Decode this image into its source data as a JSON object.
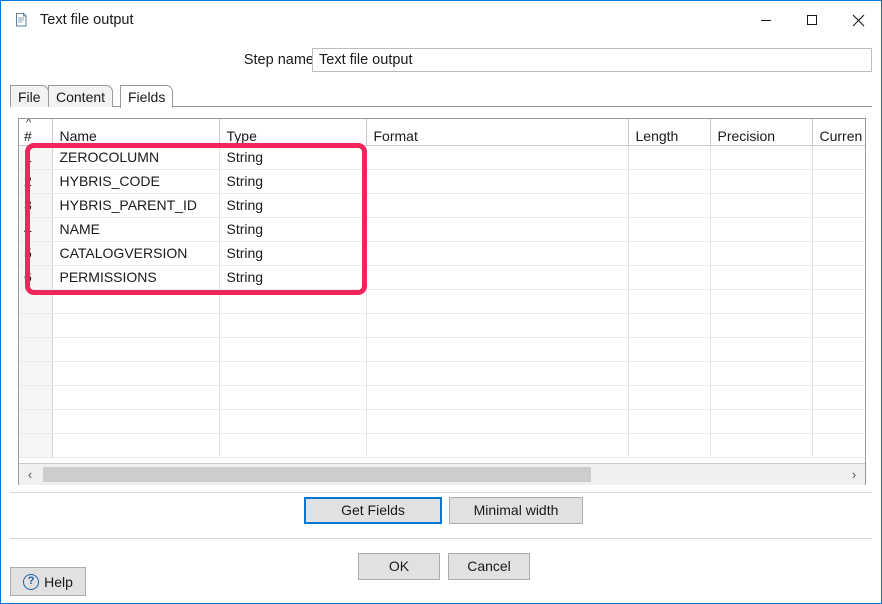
{
  "window": {
    "title": "Text file output",
    "icon": "text-file-document-icon",
    "controls": {
      "minimize": "minimize-icon",
      "maximize": "maximize-icon",
      "close": "close-icon"
    },
    "accent_border_color": "#0078d7"
  },
  "step": {
    "label": "Step name",
    "value": "Text file output",
    "placeholder": ""
  },
  "tabs": [
    {
      "label": "File",
      "active": false
    },
    {
      "label": "Content",
      "active": false
    },
    {
      "label": "Fields",
      "active": true
    }
  ],
  "table": {
    "sort_indicator": "^",
    "columns": [
      "#",
      "Name",
      "Type",
      "Format",
      "Length",
      "Precision",
      "Curren"
    ],
    "rows": [
      {
        "num": "1",
        "name": "ZEROCOLUMN",
        "type": "String",
        "format": "",
        "length": "",
        "precision": "",
        "currency": ""
      },
      {
        "num": "2",
        "name": "HYBRIS_CODE",
        "type": "String",
        "format": "",
        "length": "",
        "precision": "",
        "currency": ""
      },
      {
        "num": "3",
        "name": "HYBRIS_PARENT_ID",
        "type": "String",
        "format": "",
        "length": "",
        "precision": "",
        "currency": ""
      },
      {
        "num": "4",
        "name": "NAME",
        "type": "String",
        "format": "",
        "length": "",
        "precision": "",
        "currency": ""
      },
      {
        "num": "5",
        "name": "CATALOGVERSION",
        "type": "String",
        "format": "",
        "length": "",
        "precision": "",
        "currency": ""
      },
      {
        "num": "6",
        "name": "PERMISSIONS",
        "type": "String",
        "format": "",
        "length": "",
        "precision": "",
        "currency": ""
      }
    ],
    "empty_row_count": 7
  },
  "highlight": {
    "color": "#f0265c",
    "covers": "fields-rows-1-to-6-name-and-type"
  },
  "scrollbar": {
    "left_arrow": "‹",
    "right_arrow": "›"
  },
  "buttons": {
    "get_fields": "Get Fields",
    "minimal_width": "Minimal width",
    "ok": "OK",
    "cancel": "Cancel",
    "help": "Help",
    "help_icon": "question-mark-icon",
    "focused": "Get Fields"
  }
}
